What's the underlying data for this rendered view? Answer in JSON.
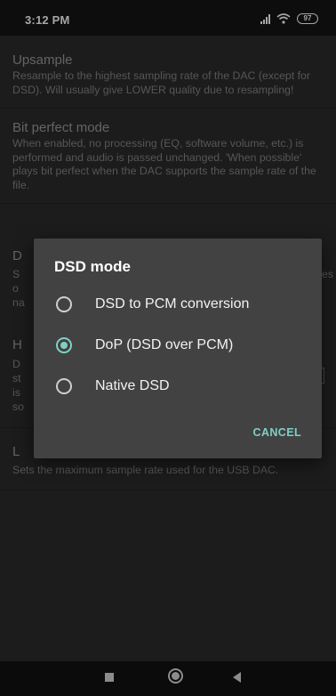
{
  "status_bar": {
    "time": "3:12 PM",
    "battery": "97",
    "icons": [
      "signal-icon",
      "wifi-icon",
      "battery-icon"
    ]
  },
  "settings": {
    "upsample": {
      "title": "Upsample",
      "summary": "Resample to the highest sampling rate of the DAC (except for DSD). Will usually give LOWER quality due to resampling!"
    },
    "bit_perfect": {
      "title": "Bit perfect mode",
      "summary": "When enabled, no processing (EQ, software volume, etc.) is performed and audio is passed unchanged. 'When possible' plays bit perfect when the DAC supports the sample rate of the file."
    },
    "dsd_peek": {
      "title": "D",
      "line1": "S",
      "line1_end": "es",
      "line2": "o",
      "line3": "na"
    },
    "hidden_peek": {
      "title": "H",
      "line1": "D",
      "line2": "st",
      "line3": "is",
      "line4": "so"
    },
    "limit": {
      "title": "L",
      "summary": "Sets the maximum sample rate used for the USB DAC."
    }
  },
  "dialog": {
    "title": "DSD mode",
    "options": [
      {
        "label": "DSD to PCM conversion",
        "selected": false
      },
      {
        "label": "DoP (DSD over PCM)",
        "selected": true
      },
      {
        "label": "Native DSD",
        "selected": false
      }
    ],
    "cancel_label": "CANCEL"
  },
  "navbar": {
    "icons": [
      "recents-icon",
      "home-icon",
      "back-icon"
    ]
  },
  "colors": {
    "accent": "#7fd0c4",
    "background": "#2b2b2b",
    "dialog": "#424242"
  }
}
